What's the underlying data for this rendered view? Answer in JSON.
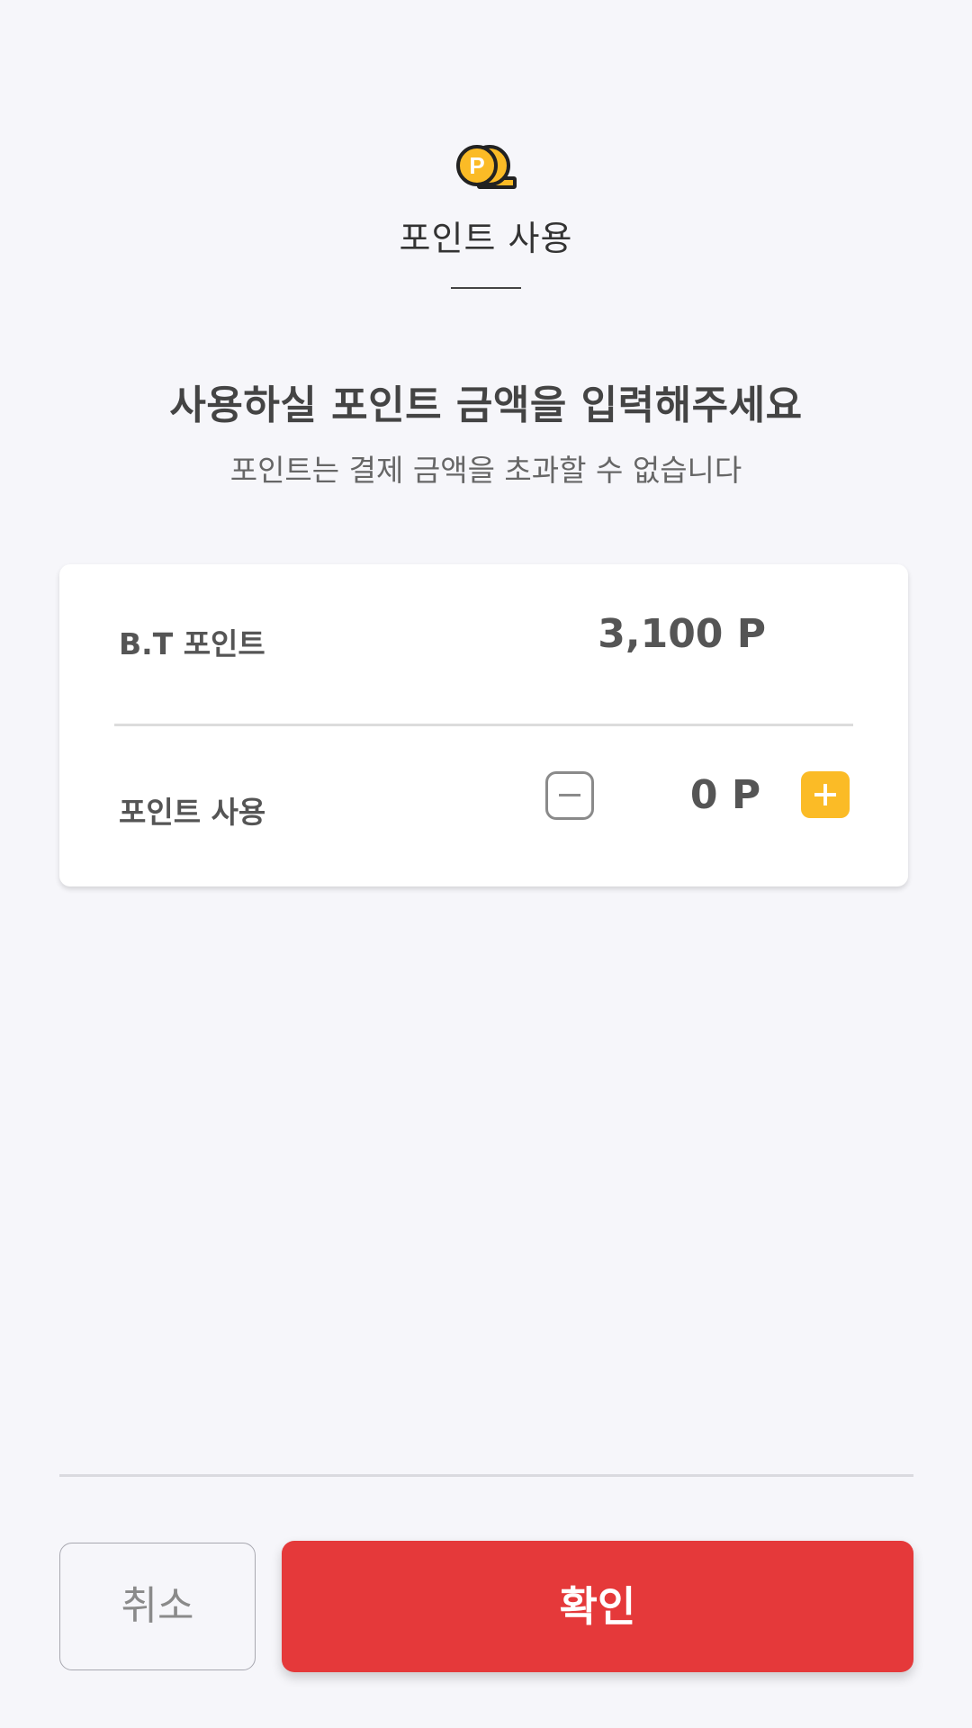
{
  "header": {
    "icon": "point-coin-icon",
    "icon_letter": "P",
    "title": "포인트 사용"
  },
  "instruction": {
    "title": "사용하실 포인트 금액을 입력해주세요",
    "subtitle": "포인트는 결제 금액을 초과할 수 없습니다"
  },
  "card": {
    "balance": {
      "label": "B.T 포인트",
      "value": "3,100 P"
    },
    "use": {
      "label": "포인트 사용",
      "value": "0 P",
      "minus_icon": "minus-icon",
      "plus_icon": "plus-icon"
    }
  },
  "footer": {
    "cancel_label": "취소",
    "confirm_label": "확인"
  },
  "colors": {
    "accent": "#fbbb26",
    "confirm": "#e5393a",
    "background": "#f6f6fa"
  }
}
